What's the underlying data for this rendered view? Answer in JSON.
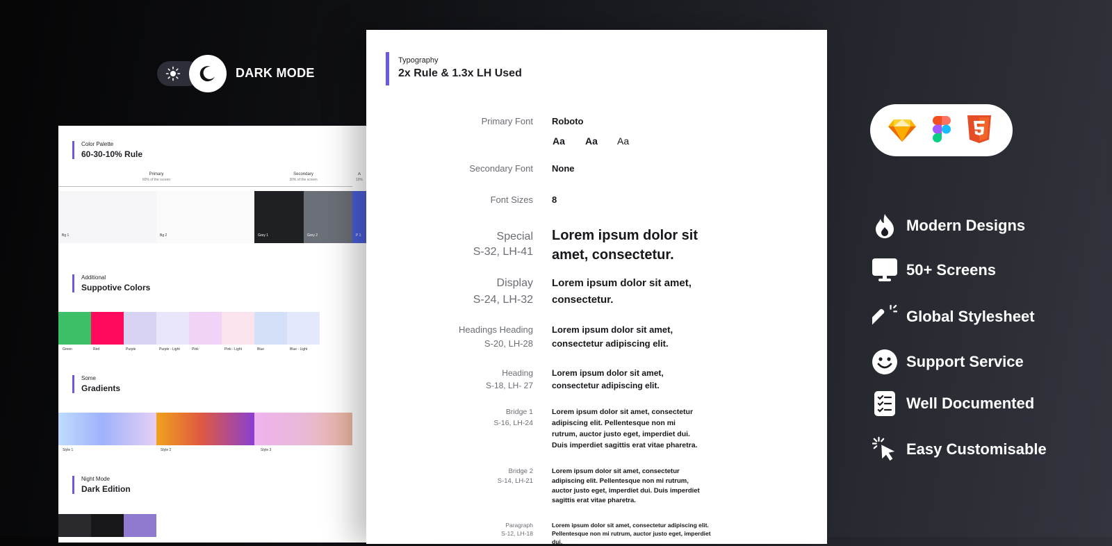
{
  "toggle": {
    "label": "DARK MODE"
  },
  "palette": {
    "section_small": "Color Palette",
    "section_title": "60-30-10% Rule",
    "columns": [
      {
        "title": "Primary",
        "sub": "60% of the screen"
      },
      {
        "title": "Secondary",
        "sub": "30% of the screen"
      },
      {
        "title": "A",
        "sub": "10%"
      }
    ],
    "swatches": [
      {
        "label": "Bg 1",
        "color": "#f5f5f7"
      },
      {
        "label": "Bg 2",
        "color": "#fafafa"
      },
      {
        "label": "Grey 1",
        "color": "#1f2024"
      },
      {
        "label": "Grey 2",
        "color": "#6b6f77"
      },
      {
        "label": "P 1",
        "color": "#4a5ed8"
      }
    ]
  },
  "additional": {
    "section_small": "Additional",
    "section_title": "Suppotive Colors",
    "swatches": [
      {
        "label": "Green",
        "color": "#3cbf67"
      },
      {
        "label": "Red",
        "color": "#ff0a5c"
      },
      {
        "label": "Purple",
        "color": "#d9d3f3"
      },
      {
        "label": "Purple - Light",
        "color": "#e9e6fb"
      },
      {
        "label": "Pink",
        "color": "#f0d3f6"
      },
      {
        "label": "Pink - Light",
        "color": "#fbe3ee"
      },
      {
        "label": "Blue",
        "color": "#d3e0f8"
      },
      {
        "label": "Blue - Light",
        "color": "#e3e8fc"
      }
    ]
  },
  "gradients": {
    "section_small": "Some",
    "section_title": "Gradients",
    "items": [
      {
        "label": "Style 1"
      },
      {
        "label": "Style 2"
      },
      {
        "label": "Style 3"
      }
    ]
  },
  "night": {
    "section_small": "Night Mode",
    "section_title": "Dark Edition",
    "colors": [
      "#2a2a2e",
      "#18181b",
      "#8f7ad0"
    ]
  },
  "typography": {
    "section_small": "Typography",
    "section_title": "2x Rule & 1.3x LH Used",
    "primary_font_label": "Primary Font",
    "primary_font_value": "Roboto",
    "aa_samples": [
      "Aa",
      "Aa",
      "Aa"
    ],
    "secondary_font_label": "Secondary Font",
    "secondary_font_value": "None",
    "font_sizes_label": "Font Sizes",
    "font_sizes_value": "8",
    "styles": [
      {
        "name": "Special",
        "spec": "S-32, LH-41",
        "sample": "Lorem ipsum dolor sit amet, consectetur."
      },
      {
        "name": "Display",
        "spec": "S-24, LH-32",
        "sample": "Lorem ipsum dolor sit amet, consectetur."
      },
      {
        "name": "Headings Heading",
        "spec": "S-20, LH-28",
        "sample": "Lorem ipsum dolor sit amet, consectetur adipiscing elit."
      },
      {
        "name": "Heading",
        "spec": "S-18, LH- 27",
        "sample": "Lorem ipsum dolor sit amet, consectetur adipiscing elit."
      },
      {
        "name": "Bridge 1",
        "spec": "S-16, LH-24",
        "sample": "Lorem ipsum dolor sit amet, consectetur adipiscing elit. Pellentesque non mi rutrum, auctor justo eget, imperdiet dui. Duis imperdiet sagittis erat vitae pharetra."
      },
      {
        "name": "Bridge 2",
        "spec": "S-14, LH-21",
        "sample": "Lorem ipsum dolor sit amet, consectetur adipiscing elit. Pellentesque non mi rutrum, auctor justo eget, imperdiet dui. Duis imperdiet sagittis erat vitae pharetra."
      },
      {
        "name": "Paragraph",
        "spec": "S-12, LH-18",
        "sample": "Lorem ipsum dolor sit amet, consectetur adipiscing elit. Pellentesque non mi rutrum, auctor justo eget, imperdiet dui."
      }
    ]
  },
  "tools": [
    "sketch-icon",
    "figma-icon",
    "html5-icon"
  ],
  "features": [
    {
      "label": "Modern Designs",
      "icon": "flame-icon"
    },
    {
      "label": "50+ Screens",
      "icon": "monitor-icon"
    },
    {
      "label": "Global Stylesheet",
      "icon": "magic-wand-icon"
    },
    {
      "label": "Support Service",
      "icon": "smiley-icon"
    },
    {
      "label": "Well Documented",
      "icon": "checklist-icon"
    },
    {
      "label": "Easy Customisable",
      "icon": "cursor-click-icon"
    }
  ]
}
